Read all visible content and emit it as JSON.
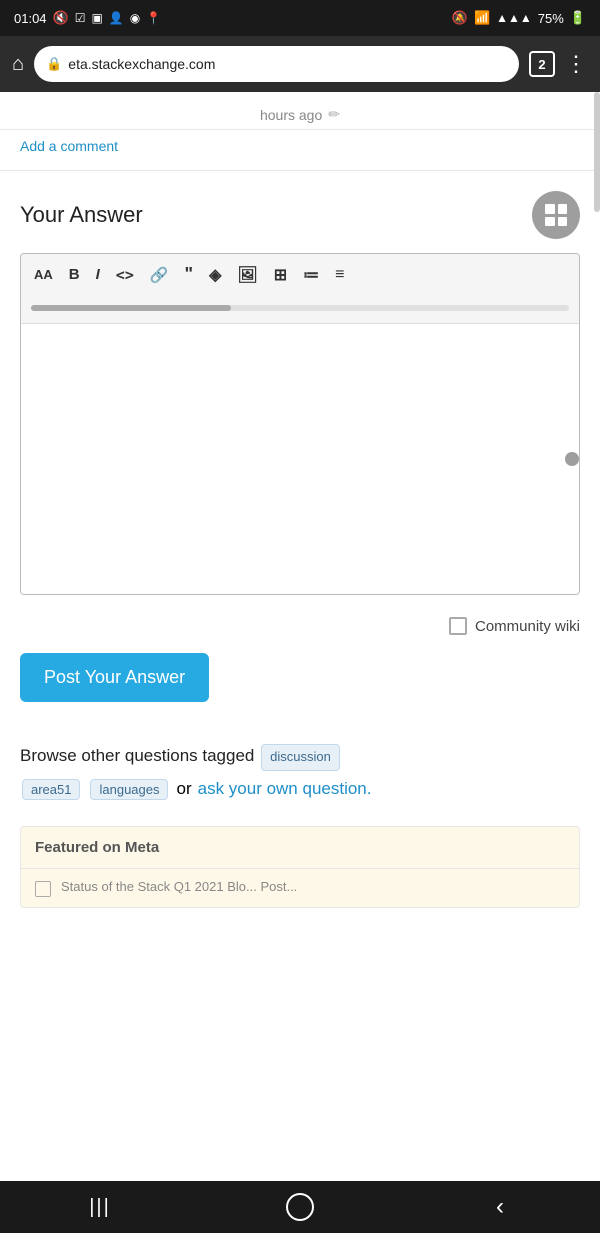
{
  "statusBar": {
    "time": "01:04",
    "battery": "75%",
    "tabCount": "2"
  },
  "browserBar": {
    "url": "eta.stackexchange.com"
  },
  "hoursAgo": {
    "text": "hours ago"
  },
  "addComment": {
    "label": "Add a comment"
  },
  "yourAnswer": {
    "title": "Your Answer",
    "toolbar": {
      "aa": "AA",
      "bold": "B",
      "italic": "I",
      "code": "<>",
      "link": "🔗",
      "quote": "❝",
      "codeblock": "◈",
      "image": "🖼",
      "table": "⊞",
      "orderedList": "≡",
      "unorderedList": "≡"
    }
  },
  "communityWiki": {
    "label": "Community wiki"
  },
  "postButton": {
    "label": "Post Your Answer"
  },
  "browseSection": {
    "prefix": "Browse other questions tagged",
    "tag1": "discussion",
    "tag2": "area51",
    "tag3": "languages",
    "or": "or",
    "linkText": "ask your own question.",
    "period": ""
  },
  "featuredSection": {
    "header": "Featured on Meta",
    "item1": "Status of the Stack Q1 2021 Blo... Post..."
  },
  "bottomNav": {
    "backIcon": "‹",
    "homeIcon": "○",
    "menuIcon": "|||"
  }
}
